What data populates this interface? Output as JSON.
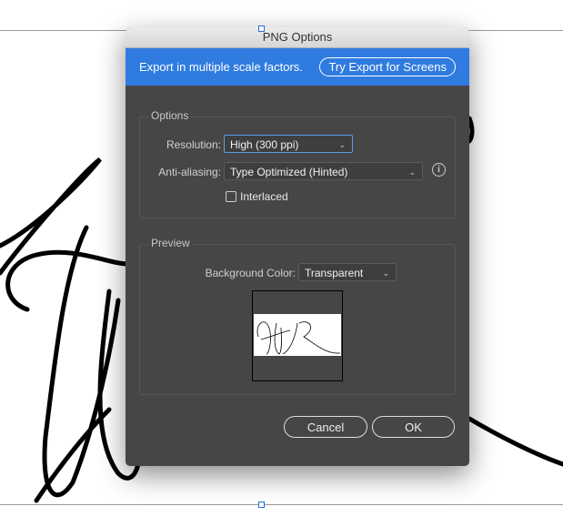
{
  "dialog": {
    "title": "PNG Options"
  },
  "banner": {
    "text": "Export in multiple scale factors.",
    "button": "Try Export for Screens"
  },
  "options": {
    "group_label": "Options",
    "resolution_label": "Resolution:",
    "resolution_value": "High (300 ppi)",
    "antialias_label": "Anti-aliasing:",
    "antialias_value": "Type Optimized (Hinted)",
    "interlaced_label": "Interlaced",
    "interlaced_checked": false
  },
  "preview": {
    "group_label": "Preview",
    "bg_label": "Background Color:",
    "bg_value": "Transparent"
  },
  "buttons": {
    "cancel": "Cancel",
    "ok": "OK"
  },
  "colors": {
    "accent": "#2f7be0",
    "dialog_bg": "#464646"
  }
}
